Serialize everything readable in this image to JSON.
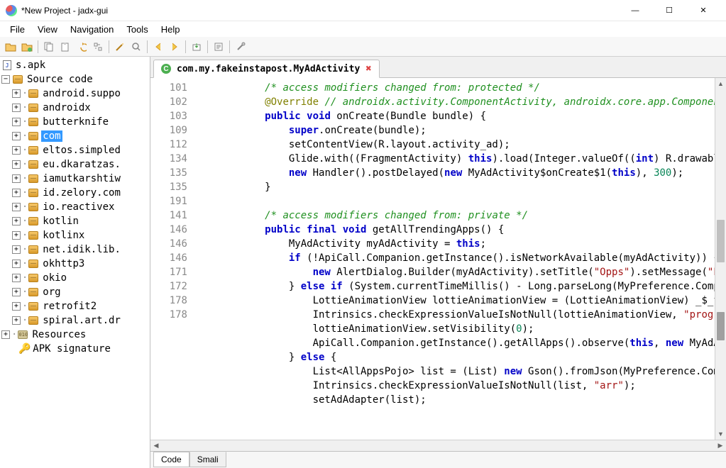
{
  "window": {
    "title": "*New Project - jadx-gui"
  },
  "menu": {
    "items": [
      "File",
      "View",
      "Navigation",
      "Tools",
      "Help"
    ]
  },
  "toolbar": {
    "icons": [
      "open-file-icon",
      "open-project-icon",
      "copy-icon",
      "paste-icon",
      "undo-icon",
      "sync-icon",
      "wand-icon",
      "search-icon",
      "back-icon",
      "forward-icon",
      "export-icon",
      "log-icon",
      "settings-icon"
    ]
  },
  "tree": {
    "root_file": "s.apk",
    "source_code_label": "Source code",
    "packages": [
      {
        "name": "android.suppo",
        "selected": false
      },
      {
        "name": "androidx",
        "selected": false
      },
      {
        "name": "butterknife",
        "selected": false
      },
      {
        "name": "com",
        "selected": true
      },
      {
        "name": "eltos.simpled",
        "selected": false
      },
      {
        "name": "eu.dkaratzas.",
        "selected": false
      },
      {
        "name": "iamutkarshtiw",
        "selected": false
      },
      {
        "name": "id.zelory.com",
        "selected": false
      },
      {
        "name": "io.reactivex",
        "selected": false
      },
      {
        "name": "kotlin",
        "selected": false
      },
      {
        "name": "kotlinx",
        "selected": false
      },
      {
        "name": "net.idik.lib.",
        "selected": false
      },
      {
        "name": "okhttp3",
        "selected": false
      },
      {
        "name": "okio",
        "selected": false
      },
      {
        "name": "org",
        "selected": false
      },
      {
        "name": "retrofit2",
        "selected": false
      },
      {
        "name": "spiral.art.dr",
        "selected": false
      }
    ],
    "resources_label": "Resources",
    "apk_signature_label": "APK signature"
  },
  "editor": {
    "tab_title": "com.my.fakeinstapost.MyAdActivity",
    "line_numbers": [
      "",
      "",
      "101",
      "102",
      "103",
      "109",
      "112",
      "",
      "",
      "",
      "134",
      "135",
      "135",
      "191",
      "141",
      "146",
      "146",
      "146",
      "171",
      "",
      "172",
      "178",
      "178"
    ],
    "code_lines": [
      {
        "indent": 3,
        "tokens": [
          {
            "t": "cm",
            "v": "/* access modifiers changed from: protected */"
          }
        ]
      },
      {
        "indent": 3,
        "tokens": [
          {
            "t": "an",
            "v": "@Override"
          },
          {
            "t": "",
            "v": " "
          },
          {
            "t": "cm",
            "v": "// androidx.activity.ComponentActivity, androidx.core.app.Componen"
          }
        ]
      },
      {
        "indent": 3,
        "tokens": [
          {
            "t": "kw",
            "v": "public void"
          },
          {
            "t": "",
            "v": " onCreate(Bundle bundle) {"
          }
        ]
      },
      {
        "indent": 4,
        "tokens": [
          {
            "t": "kw",
            "v": "super"
          },
          {
            "t": "",
            "v": ".onCreate(bundle);"
          }
        ]
      },
      {
        "indent": 4,
        "tokens": [
          {
            "t": "",
            "v": "setContentView(R.layout.activity_ad);"
          }
        ]
      },
      {
        "indent": 4,
        "tokens": [
          {
            "t": "",
            "v": "Glide.with((FragmentActivity) "
          },
          {
            "t": "kw",
            "v": "this"
          },
          {
            "t": "",
            "v": ").load(Integer.valueOf(("
          },
          {
            "t": "kw",
            "v": "int"
          },
          {
            "t": "",
            "v": ") R.drawable"
          }
        ]
      },
      {
        "indent": 4,
        "tokens": [
          {
            "t": "kw",
            "v": "new"
          },
          {
            "t": "",
            "v": " Handler().postDelayed("
          },
          {
            "t": "kw",
            "v": "new"
          },
          {
            "t": "",
            "v": " MyAdActivity$onCreate$1("
          },
          {
            "t": "kw",
            "v": "this"
          },
          {
            "t": "",
            "v": "), "
          },
          {
            "t": "nm",
            "v": "300"
          },
          {
            "t": "",
            "v": ");"
          }
        ]
      },
      {
        "indent": 3,
        "tokens": [
          {
            "t": "",
            "v": "}"
          }
        ]
      },
      {
        "indent": 0,
        "tokens": [
          {
            "t": "",
            "v": ""
          }
        ]
      },
      {
        "indent": 3,
        "tokens": [
          {
            "t": "cm",
            "v": "/* access modifiers changed from: private */"
          }
        ]
      },
      {
        "indent": 3,
        "tokens": [
          {
            "t": "kw",
            "v": "public final void"
          },
          {
            "t": "",
            "v": " getAllTrendingApps() {"
          }
        ]
      },
      {
        "indent": 4,
        "tokens": [
          {
            "t": "",
            "v": "MyAdActivity myAdActivity = "
          },
          {
            "t": "kw",
            "v": "this"
          },
          {
            "t": "",
            "v": ";"
          }
        ]
      },
      {
        "indent": 4,
        "tokens": [
          {
            "t": "kw",
            "v": "if"
          },
          {
            "t": "",
            "v": " (!ApiCall.Companion.getInstance().isNetworkAvailable(myAdActivity)) {"
          }
        ]
      },
      {
        "indent": 5,
        "tokens": [
          {
            "t": "kw",
            "v": "new"
          },
          {
            "t": "",
            "v": " AlertDialog.Builder(myAdActivity).setTitle("
          },
          {
            "t": "st",
            "v": "\"Opps\""
          },
          {
            "t": "",
            "v": ").setMessage("
          },
          {
            "t": "st",
            "v": "\"Pl"
          }
        ]
      },
      {
        "indent": 4,
        "tokens": [
          {
            "t": "",
            "v": "} "
          },
          {
            "t": "kw",
            "v": "else if"
          },
          {
            "t": "",
            "v": " (System.currentTimeMillis() - Long.parseLong(MyPreference.Compa"
          }
        ]
      },
      {
        "indent": 5,
        "tokens": [
          {
            "t": "",
            "v": "LottieAnimationView lottieAnimationView = (LottieAnimationView) _$_f"
          }
        ]
      },
      {
        "indent": 5,
        "tokens": [
          {
            "t": "",
            "v": "Intrinsics.checkExpressionValueIsNotNull(lottieAnimationView, "
          },
          {
            "t": "st",
            "v": "\"progr"
          }
        ]
      },
      {
        "indent": 5,
        "tokens": [
          {
            "t": "",
            "v": "lottieAnimationView.setVisibility("
          },
          {
            "t": "nm",
            "v": "0"
          },
          {
            "t": "",
            "v": ");"
          }
        ]
      },
      {
        "indent": 5,
        "tokens": [
          {
            "t": "",
            "v": "ApiCall.Companion.getInstance().getAllApps().observe("
          },
          {
            "t": "kw",
            "v": "this"
          },
          {
            "t": "",
            "v": ", "
          },
          {
            "t": "kw",
            "v": "new"
          },
          {
            "t": "",
            "v": " MyAdAc"
          }
        ]
      },
      {
        "indent": 4,
        "tokens": [
          {
            "t": "",
            "v": "} "
          },
          {
            "t": "kw",
            "v": "else"
          },
          {
            "t": "",
            "v": " {"
          }
        ]
      },
      {
        "indent": 5,
        "tokens": [
          {
            "t": "",
            "v": "List<AllAppsPojo> list = (List) "
          },
          {
            "t": "kw",
            "v": "new"
          },
          {
            "t": "",
            "v": " Gson().fromJson(MyPreference.Comp"
          }
        ]
      },
      {
        "indent": 5,
        "tokens": [
          {
            "t": "",
            "v": "Intrinsics.checkExpressionValueIsNotNull(list, "
          },
          {
            "t": "st",
            "v": "\"arr\""
          },
          {
            "t": "",
            "v": ");"
          }
        ]
      },
      {
        "indent": 5,
        "tokens": [
          {
            "t": "",
            "v": "setAdAdapter(list);"
          }
        ]
      }
    ],
    "bottom_tabs": [
      "Code",
      "Smali"
    ]
  }
}
